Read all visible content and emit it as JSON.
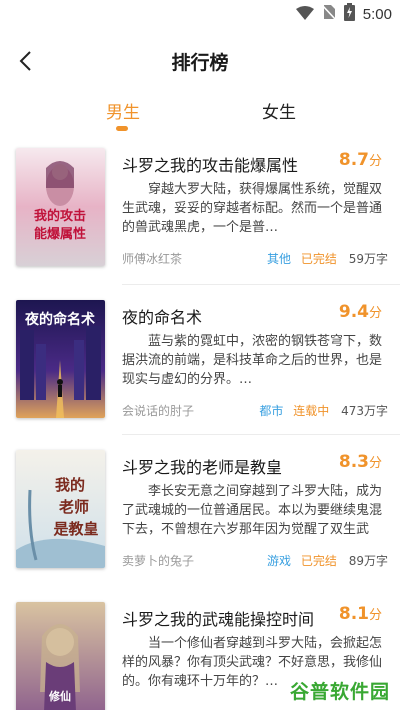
{
  "status_bar": {
    "time": "5:00"
  },
  "header": {
    "title": "排行榜"
  },
  "tabs": [
    {
      "label": "男生"
    },
    {
      "label": "女生"
    }
  ],
  "books": [
    {
      "title": "斗罗之我的攻击能爆属性",
      "score": "8.7",
      "score_unit": "分",
      "desc": "穿越大罗大陆，获得爆属性系统，觉醒双生武魂，妥妥的穿越者标配。然而一个是普通的兽武魂黑虎，一个是普…",
      "author": "师傅冰红茶",
      "genre": "其他",
      "status": "已完结",
      "words": "59万字",
      "cover_text": "我的攻击能爆属性"
    },
    {
      "title": "夜的命名术",
      "score": "9.4",
      "score_unit": "分",
      "desc": "蓝与紫的霓虹中，浓密的钢铁苍穹下，数据洪流的前端，是科技革命之后的世界，也是现实与虚幻的分界。…",
      "author": "会说话的肘子",
      "genre": "都市",
      "status": "连载中",
      "words": "473万字",
      "cover_text": "夜的命名术"
    },
    {
      "title": "斗罗之我的老师是教皇",
      "score": "8.3",
      "score_unit": "分",
      "desc": "李长安无意之间穿越到了斗罗大陆，成为了武魂城的一位普通居民。本以为要继续鬼混下去，不曾想在六岁那年因为觉醒了双生武魂…",
      "author": "卖萝卜的兔子",
      "genre": "游戏",
      "status": "已完结",
      "words": "89万字",
      "cover_text": "我的老师是教皇"
    },
    {
      "title": "斗罗之我的武魂能操控时间",
      "score": "8.1",
      "score_unit": "分",
      "desc": "当一个修仙者穿越到斗罗大陆，会掀起怎样的风暴？你有顶尖武魂？不好意思，我修仙的。你有魂环十万年的？…",
      "author": "",
      "genre": "",
      "status": "",
      "words": "",
      "cover_text": "修仙"
    }
  ],
  "watermark": {
    "text": "谷普软件园"
  },
  "colors": {
    "accent": "#f0932b",
    "genre": "#3aa0e0",
    "watermark": "#39a833"
  }
}
